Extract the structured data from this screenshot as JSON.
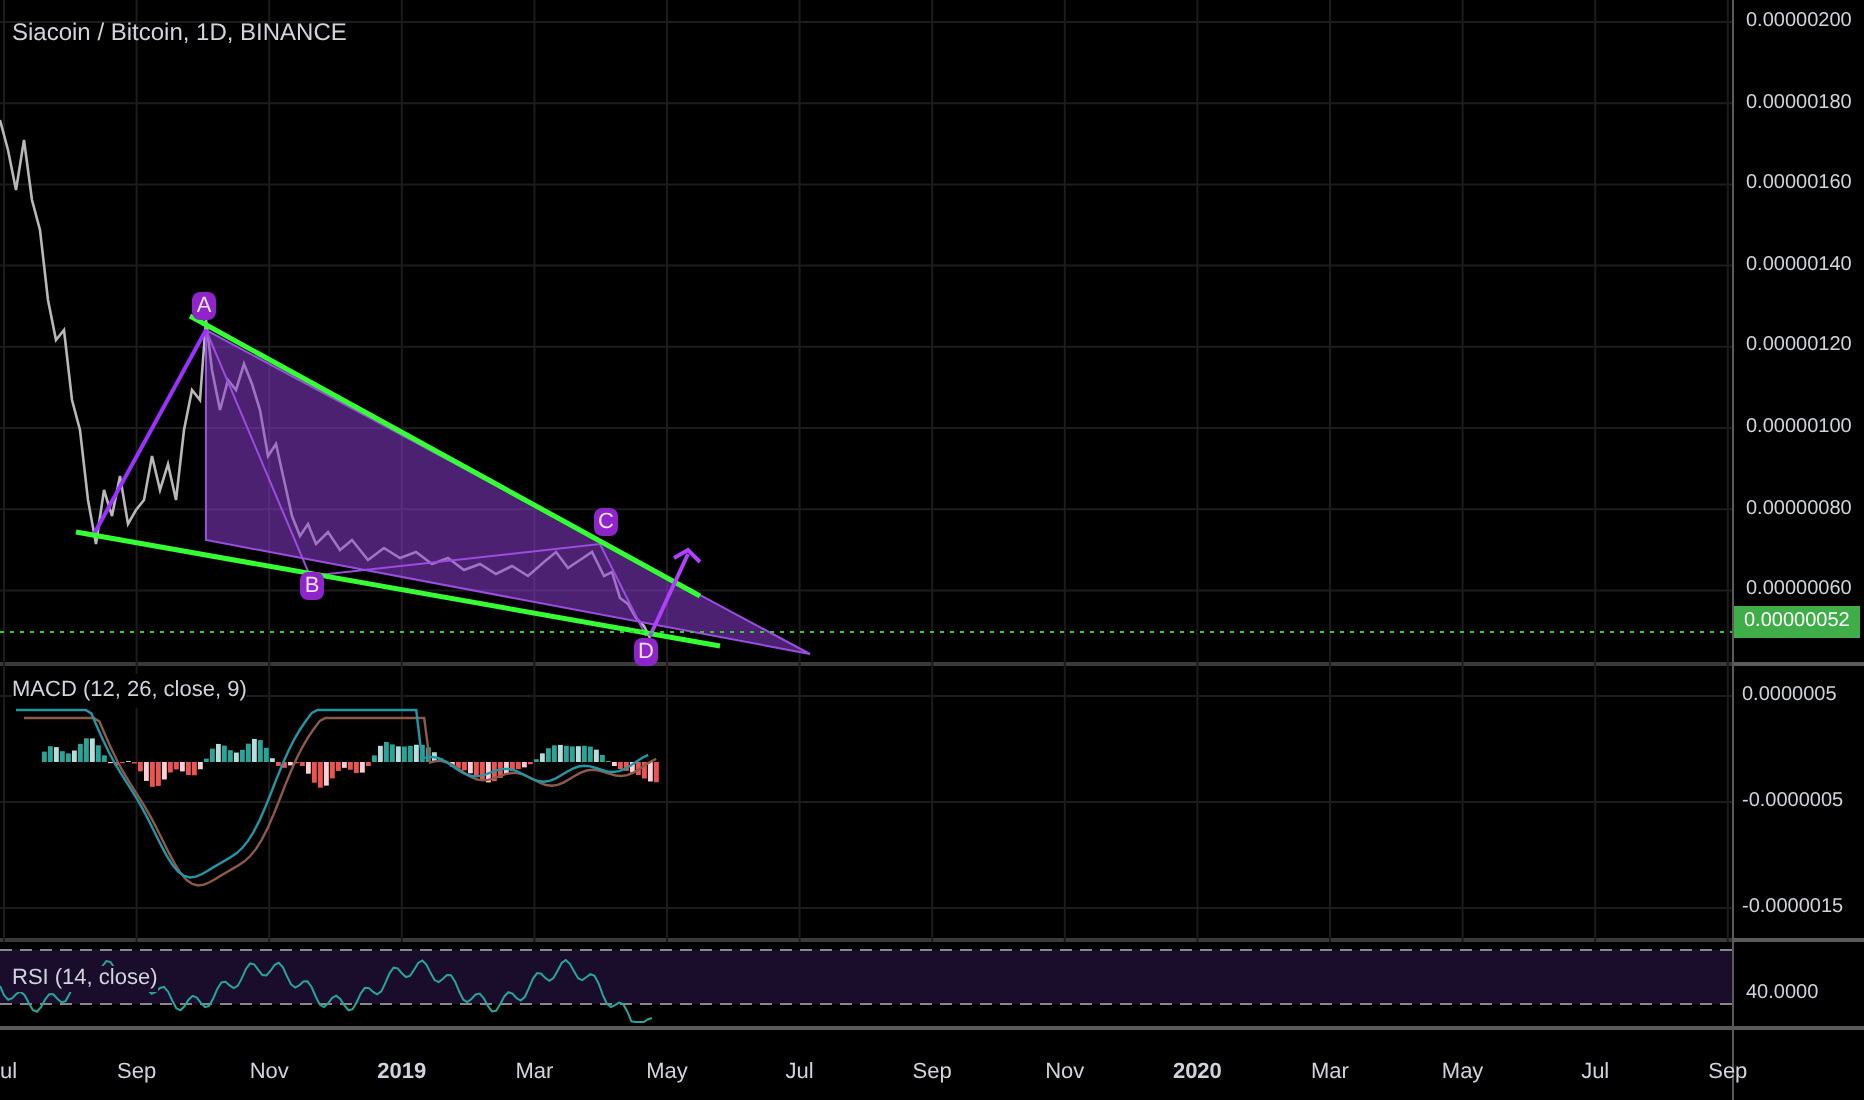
{
  "title": "Siacoin / Bitcoin, 1D, BINANCE",
  "price_axis": {
    "labels": [
      "0.00000200",
      "0.00000180",
      "0.00000160",
      "0.00000140",
      "0.00000120",
      "0.00000100",
      "0.00000080",
      "0.00000060"
    ],
    "current_price": "0.00000052"
  },
  "pattern_points": [
    {
      "label": "A"
    },
    {
      "label": "B"
    },
    {
      "label": "C"
    },
    {
      "label": "D"
    }
  ],
  "macd": {
    "title": "MACD (12, 26, close, 9)",
    "axis_labels": [
      "0.0000005",
      "-0.0000005",
      "-0.0000015"
    ]
  },
  "rsi": {
    "title": "RSI (14, close)",
    "axis_labels": [
      "40.0000"
    ]
  },
  "time_axis": [
    {
      "label": "ul",
      "bold": false
    },
    {
      "label": "Sep",
      "bold": false
    },
    {
      "label": "Nov",
      "bold": false
    },
    {
      "label": "2019",
      "bold": true
    },
    {
      "label": "Mar",
      "bold": false
    },
    {
      "label": "May",
      "bold": false
    },
    {
      "label": "Jul",
      "bold": false
    },
    {
      "label": "Sep",
      "bold": false
    },
    {
      "label": "Nov",
      "bold": false
    },
    {
      "label": "2020",
      "bold": true
    },
    {
      "label": "Mar",
      "bold": false
    },
    {
      "label": "May",
      "bold": false
    },
    {
      "label": "Jul",
      "bold": false
    },
    {
      "label": "Sep",
      "bold": false
    }
  ]
}
